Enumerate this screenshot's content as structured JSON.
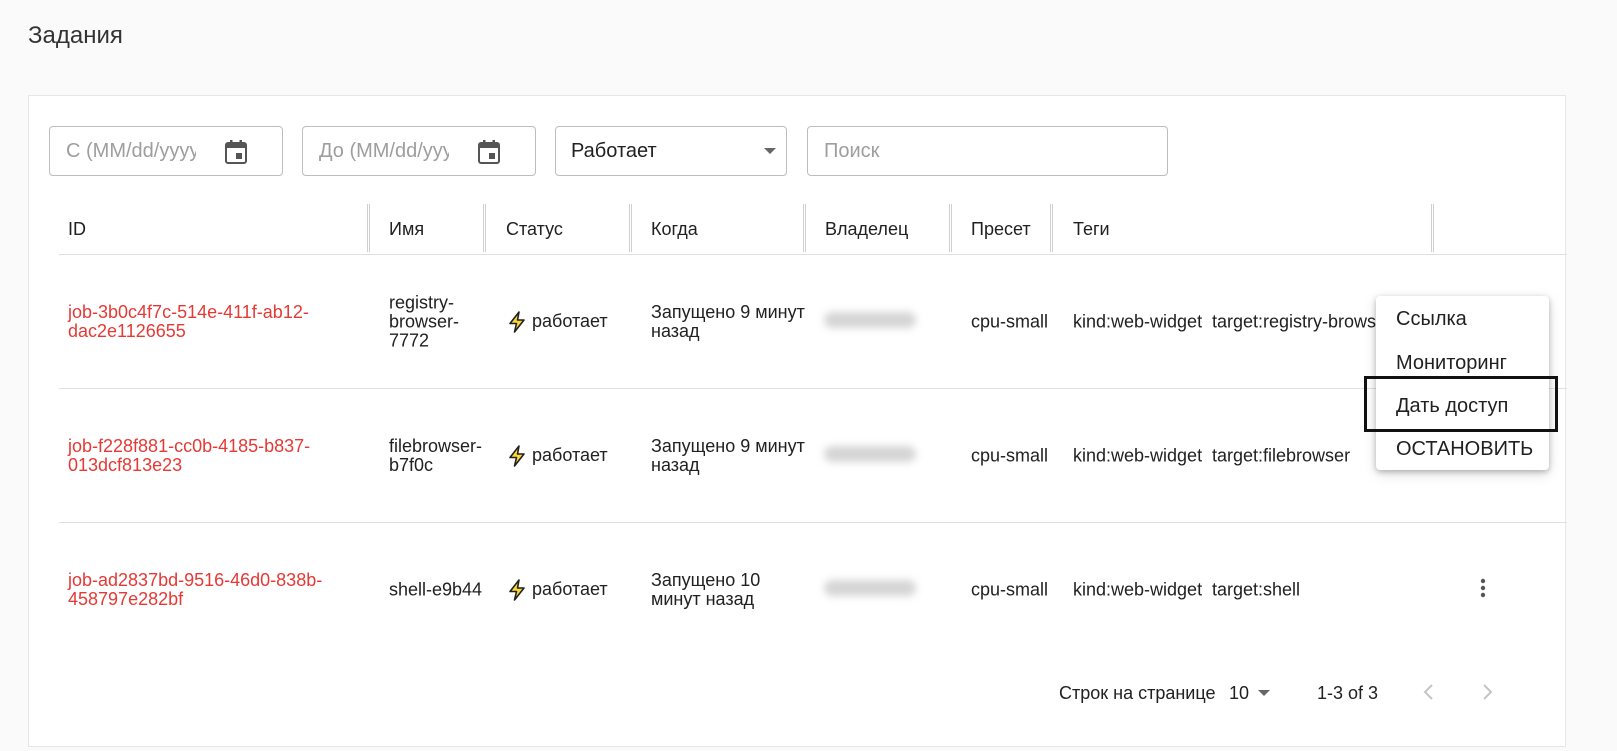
{
  "page": {
    "title": "Задания"
  },
  "filters": {
    "date_from_placeholder": "С (MM/dd/yyyy)",
    "date_to_placeholder": "До (MM/dd/yyyy)",
    "status_value": "Работает",
    "search_placeholder": "Поиск"
  },
  "table": {
    "headers": {
      "id": "ID",
      "name": "Имя",
      "status": "Статус",
      "when": "Когда",
      "owner": "Владелец",
      "preset": "Пресет",
      "tags": "Теги"
    },
    "rows": [
      {
        "id": "job-3b0c4f7c-514e-411f-ab12-dac2e1126655",
        "name": "registry-browser-7772",
        "status": "работает",
        "when": "Запущено 9 минут назад",
        "preset": "cpu-small",
        "tag1": "kind:web-widget",
        "tag2": "target:registry-browser"
      },
      {
        "id": "job-f228f881-cc0b-4185-b837-013dcf813e23",
        "name": "filebrowser-b7f0c",
        "status": "работает",
        "when": "Запущено 9 минут назад",
        "preset": "cpu-small",
        "tag1": "kind:web-widget",
        "tag2": "target:filebrowser"
      },
      {
        "id": "job-ad2837bd-9516-46d0-838b-458797e282bf",
        "name": "shell-e9b44",
        "status": "работает",
        "when": "Запущено 10 минут назад",
        "preset": "cpu-small",
        "tag1": "kind:web-widget",
        "tag2": "target:shell"
      }
    ]
  },
  "pagination": {
    "rows_per_page_label": "Строк на странице",
    "rows_per_page_value": "10",
    "range": "1-3 of 3"
  },
  "context_menu": {
    "items": [
      "Ссылка",
      "Мониторинг",
      "Дать доступ",
      "ОСТАНОВИТЬ"
    ]
  },
  "colors": {
    "job_id": "#e53935",
    "status_icon": "#f9a825",
    "highlight": "#111111"
  },
  "icons": {
    "date": "calendar-icon",
    "status": "bolt-icon",
    "row_actions": "more-vert-icon",
    "prev": "chevron-left-icon",
    "next": "chevron-right-icon"
  }
}
